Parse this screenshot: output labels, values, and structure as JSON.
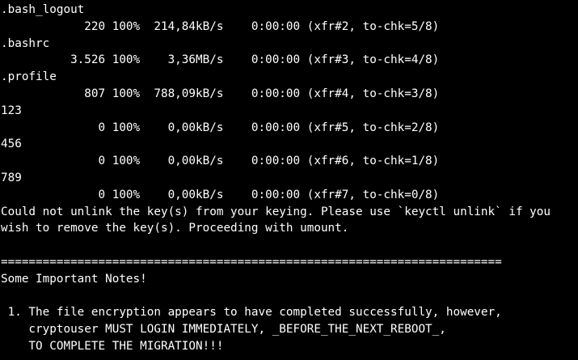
{
  "terminal": {
    "colors": {
      "background": "#000000",
      "foreground": "#ffffff"
    },
    "lines": [
      ".bash_logout",
      "            220 100%  214,84kB/s    0:00:00 (xfr#2, to-chk=5/8)",
      ".bashrc",
      "          3.526 100%    3,36MB/s    0:00:00 (xfr#3, to-chk=4/8)",
      ".profile",
      "            807 100%  788,09kB/s    0:00:00 (xfr#4, to-chk=3/8)",
      "123",
      "              0 100%    0,00kB/s    0:00:00 (xfr#5, to-chk=2/8)",
      "456",
      "              0 100%    0,00kB/s    0:00:00 (xfr#6, to-chk=1/8)",
      "789",
      "              0 100%    0,00kB/s    0:00:00 (xfr#7, to-chk=0/8)",
      "Could not unlink the key(s) from your keying. Please use `keyctl unlink` if you",
      "wish to remove the key(s). Proceeding with umount.",
      "",
      "========================================================================",
      "Some Important Notes!",
      "",
      " 1. The file encryption appears to have completed successfully, however,",
      "    cryptouser MUST LOGIN IMMEDIATELY, _BEFORE_THE_NEXT_REBOOT_,",
      "    TO COMPLETE THE MIGRATION!!!"
    ]
  }
}
